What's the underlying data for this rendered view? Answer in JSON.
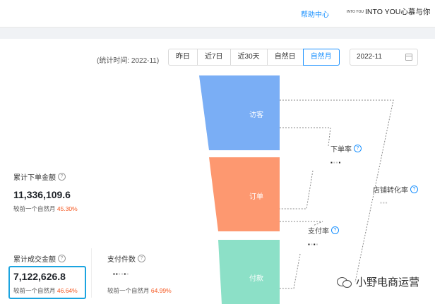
{
  "header": {
    "help_link": "帮助中心",
    "brand_logo_text": "INTO YOU",
    "brand_name": "INTO YOU心慕与你"
  },
  "toolbar": {
    "stat_time": "(统计时间: 2022-11)",
    "ranges": [
      "昨日",
      "近7日",
      "近30天",
      "自然日",
      "自然月"
    ],
    "active_range": "自然月",
    "date_value": "2022-11"
  },
  "metrics": {
    "order_amount": {
      "label": "累计下单金额",
      "value": "11,336,109.6",
      "compare_text": "较前一个自然月",
      "compare_pct": "45.30%"
    },
    "deal_amount": {
      "label": "累计成交金额",
      "value": "7,122,626.8",
      "compare_text": "较前一个自然月",
      "compare_pct": "46.64%"
    },
    "paid_items": {
      "label": "支付件数",
      "compare_text": "较前一个自然月",
      "compare_pct": "64.99%"
    }
  },
  "funnel": {
    "stages": [
      {
        "label": "访客",
        "color": "#7aaef5"
      },
      {
        "label": "订单",
        "color": "#fd9870"
      },
      {
        "label": "付款",
        "color": "#8ce0c7"
      }
    ],
    "rates": {
      "order_rate": "下单率",
      "pay_rate": "支付率",
      "store_conversion": "店铺转化率"
    }
  },
  "watermark": "小野电商运营",
  "colors": {
    "accent": "#1890ff",
    "positive_pct": "#f5541c",
    "highlight_border": "#1ba4e0"
  }
}
